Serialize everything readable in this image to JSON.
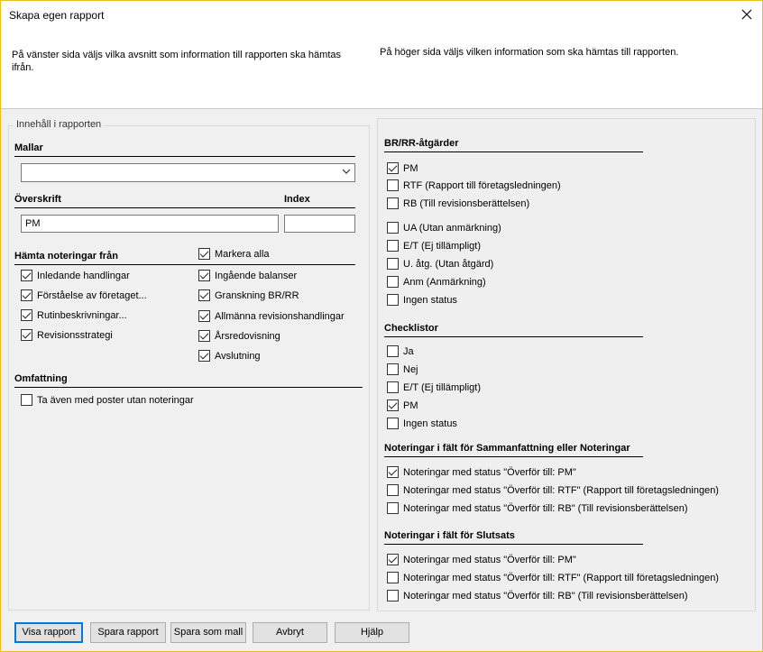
{
  "window": {
    "title": "Skapa egen rapport"
  },
  "info": {
    "left": "På vänster sida väljs vilka avsnitt som information till rapporten ska hämtas ifrån.",
    "right": "På höger sida väljs vilken information som ska hämtas till rapporten."
  },
  "left": {
    "group_title": "Innehåll i rapporten",
    "mallar_label": "Mallar",
    "mallar_value": "",
    "overskrift_label": "Överskrift",
    "index_label": "Index",
    "overskrift_value": "PM",
    "index_value": "",
    "hamta_label": "Hämta noteringar från",
    "markera_alla": {
      "label": "Markera alla",
      "checked": true
    },
    "col1": [
      {
        "label": "Inledande handlingar",
        "checked": true
      },
      {
        "label": "Förståelse av företaget...",
        "checked": true
      },
      {
        "label": "Rutinbeskrivningar...",
        "checked": true
      },
      {
        "label": "Revisionsstrategi",
        "checked": true
      }
    ],
    "col2": [
      {
        "label": "Ingående balanser",
        "checked": true
      },
      {
        "label": "Granskning BR/RR",
        "checked": true
      },
      {
        "label": "Allmänna revisionshandlingar",
        "checked": true
      },
      {
        "label": "Årsredovisning",
        "checked": true
      },
      {
        "label": "Avslutning",
        "checked": true
      }
    ],
    "omfattning_label": "Omfattning",
    "omfattning_item": {
      "label": "Ta även med poster utan noteringar",
      "checked": false
    }
  },
  "right": {
    "br_label": "BR/RR-åtgärder",
    "br_items": [
      {
        "label": "PM",
        "checked": true
      },
      {
        "label": "RTF (Rapport till företagsledningen)",
        "checked": false
      },
      {
        "label": "RB (Till revisionsberättelsen)",
        "checked": false
      },
      {
        "label": "UA (Utan anmärkning)",
        "checked": false
      },
      {
        "label": "E/T (Ej tillämpligt)",
        "checked": false
      },
      {
        "label": "U. åtg. (Utan åtgärd)",
        "checked": false
      },
      {
        "label": "Anm (Anmärkning)",
        "checked": false
      },
      {
        "label": "Ingen status",
        "checked": false
      }
    ],
    "check_label": "Checklistor",
    "check_items": [
      {
        "label": "Ja",
        "checked": false
      },
      {
        "label": "Nej",
        "checked": false
      },
      {
        "label": "E/T (Ej tillämpligt)",
        "checked": false
      },
      {
        "label": "PM",
        "checked": true
      },
      {
        "label": "Ingen status",
        "checked": false
      }
    ],
    "samm_label": "Noteringar i fält för Sammanfattning eller Noteringar",
    "samm_items": [
      {
        "label": "Noteringar med status \"Överför till: PM\"",
        "checked": true
      },
      {
        "label": "Noteringar med status \"Överför till: RTF\" (Rapport till företagsledningen)",
        "checked": false
      },
      {
        "label": "Noteringar med status \"Överför till: RB\" (Till revisionsberättelsen)",
        "checked": false
      }
    ],
    "slut_label": "Noteringar i fält för Slutsats",
    "slut_items": [
      {
        "label": "Noteringar med status \"Överför till: PM\"",
        "checked": true
      },
      {
        "label": "Noteringar med status \"Överför till: RTF\" (Rapport till företagsledningen)",
        "checked": false
      },
      {
        "label": "Noteringar med status \"Överför till: RB\" (Till revisionsberättelsen)",
        "checked": false
      }
    ]
  },
  "buttons": {
    "visa": "Visa rapport",
    "spara": "Spara rapport",
    "spara_mall": "Spara som mall",
    "avbryt": "Avbryt",
    "hjalp": "Hjälp"
  }
}
